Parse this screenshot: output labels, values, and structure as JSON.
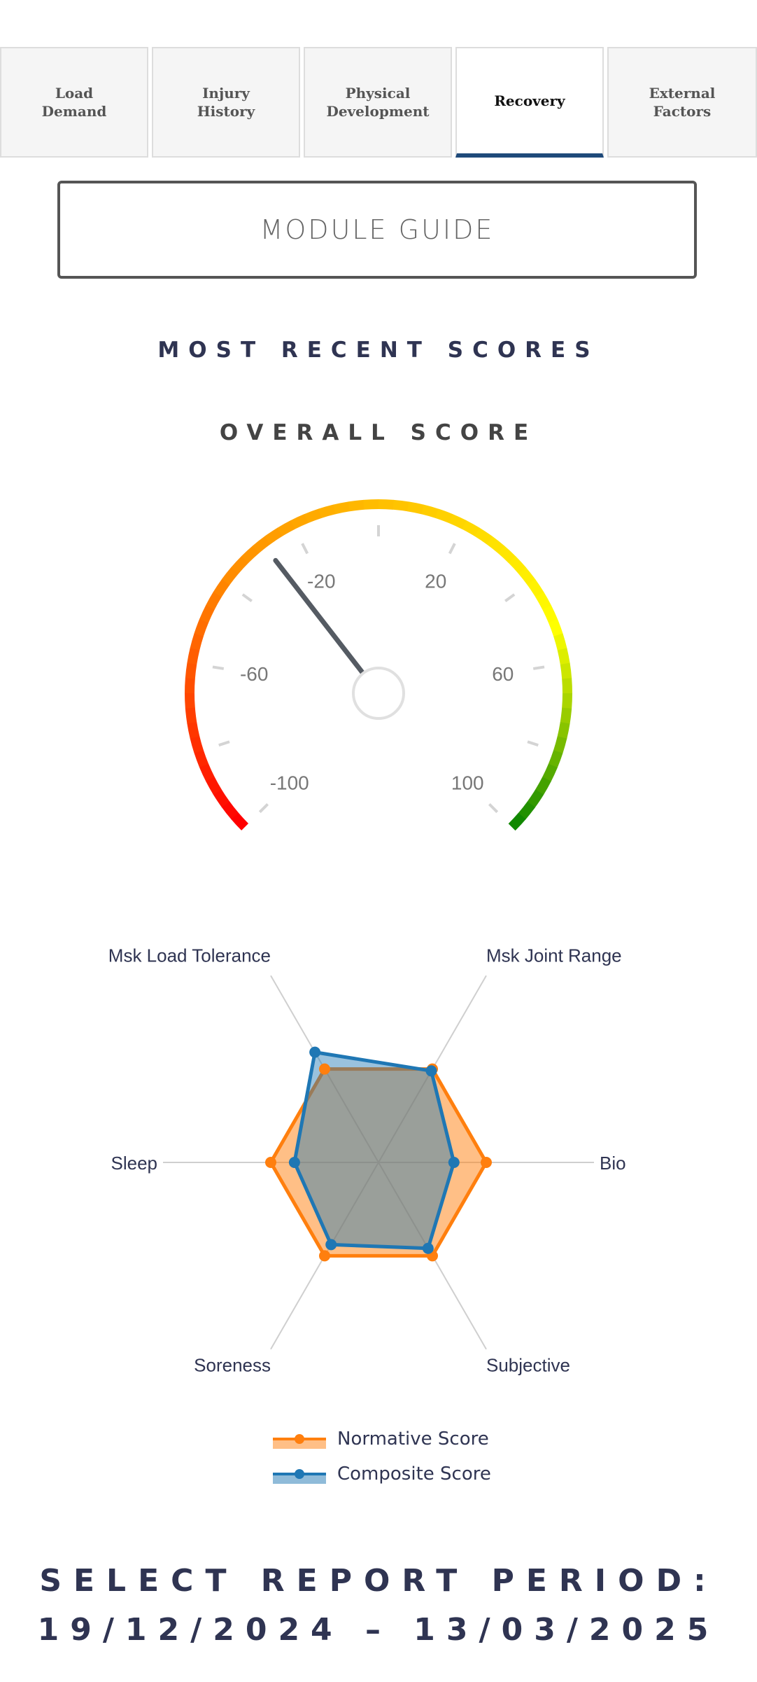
{
  "tabs": [
    {
      "label": "Load\nDemand",
      "active": false
    },
    {
      "label": "Injury\nHistory",
      "active": false
    },
    {
      "label": "Physical\nDevelopment",
      "active": false
    },
    {
      "label": "Recovery",
      "active": true
    },
    {
      "label": "External\nFactors",
      "active": false
    }
  ],
  "guide_button": "MODULE GUIDE",
  "recent_heading": "MOST RECENT SCORES",
  "overall_heading": "OVERALL SCORE",
  "gauge": {
    "min": -100,
    "max": 100,
    "value": -28,
    "tick_labels": [
      "-100",
      "-60",
      "-20",
      "20",
      "60",
      "100"
    ],
    "colors": [
      "#ff0000",
      "#ff8c00",
      "#ffc000",
      "#ffff00",
      "#008000"
    ],
    "needle_color": "#555b63"
  },
  "chart_data": {
    "type": "radar",
    "axes": [
      "Msk Joint Range",
      "Bio",
      "Subjective",
      "Soreness",
      "Sleep",
      "Msk Load Tolerance"
    ],
    "rmax": 100,
    "series": [
      {
        "name": "Normative Score",
        "values": [
          50,
          50,
          50,
          50,
          50,
          50
        ],
        "color": "#ff7f0e"
      },
      {
        "name": "Composite Score",
        "values": [
          49,
          35,
          46,
          44,
          39,
          59
        ],
        "color": "#1f77b4"
      }
    ]
  },
  "legend": [
    "Normative Score",
    "Composite Score"
  ],
  "report_heading": "SELECT REPORT PERIOD:",
  "report_dates": "19/12/2024 – 13/03/2025"
}
